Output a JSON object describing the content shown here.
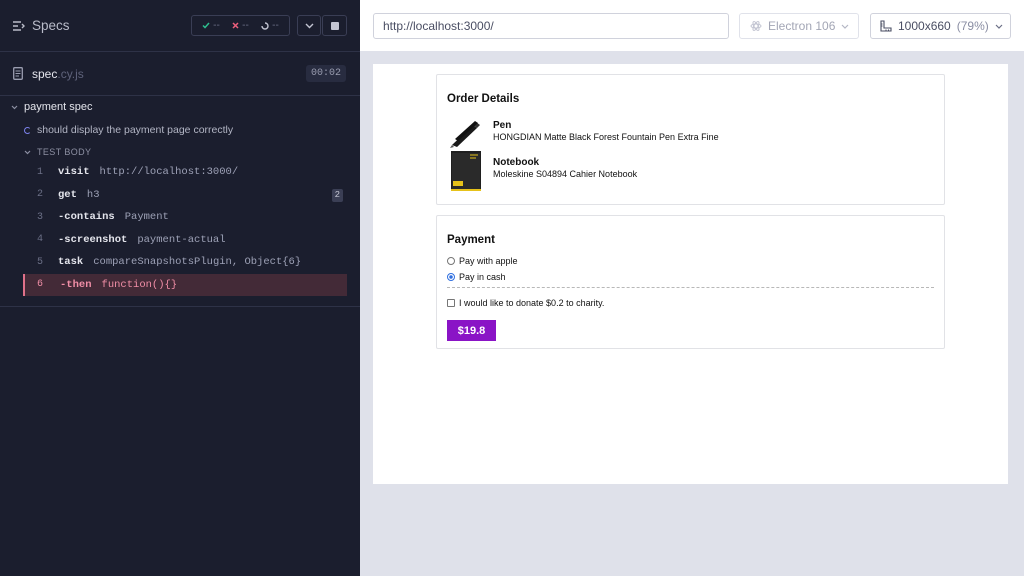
{
  "reporter": {
    "specs_label": "Specs",
    "stats": {
      "passed": "--",
      "failed": "--",
      "pending": "--"
    },
    "file": {
      "name": "spec",
      "ext": ".cy.js",
      "duration": "00:02"
    },
    "suite": "payment spec",
    "test": "should display the payment page correctly",
    "body_label": "TEST BODY",
    "commands": [
      {
        "num": "1",
        "name": "visit",
        "arg": "http://localhost:3000/"
      },
      {
        "num": "2",
        "name": "get",
        "arg": "h3",
        "badge": "2"
      },
      {
        "num": "3",
        "name": "-contains",
        "arg": "Payment"
      },
      {
        "num": "4",
        "name": "-screenshot",
        "arg": "payment-actual"
      },
      {
        "num": "5",
        "name": "task",
        "arg": "compareSnapshotsPlugin, Object{6}"
      },
      {
        "num": "6",
        "name": "-then",
        "arg": "function(){}"
      }
    ]
  },
  "aut": {
    "url": "http://localhost:3000/",
    "browser": "Electron 106",
    "viewport": "1000x660",
    "scale": "(79%)"
  },
  "app": {
    "order_title": "Order Details",
    "items": [
      {
        "title": "Pen",
        "desc": "HONGDIAN Matte Black Forest Fountain Pen Extra Fine"
      },
      {
        "title": "Notebook",
        "desc": "Moleskine S04894 Cahier Notebook"
      }
    ],
    "payment_title": "Payment",
    "options": [
      {
        "label": "Pay with apple",
        "selected": false
      },
      {
        "label": "Pay in cash",
        "selected": true
      }
    ],
    "donate_label": "I would like to donate $0.2 to charity.",
    "pay_button": "$19.8"
  },
  "colors": {
    "reporter_bg": "#1b1e2e",
    "failed": "#f08ea6",
    "pay_button": "#8a14c6",
    "radio_selected": "#2f6fe0"
  }
}
